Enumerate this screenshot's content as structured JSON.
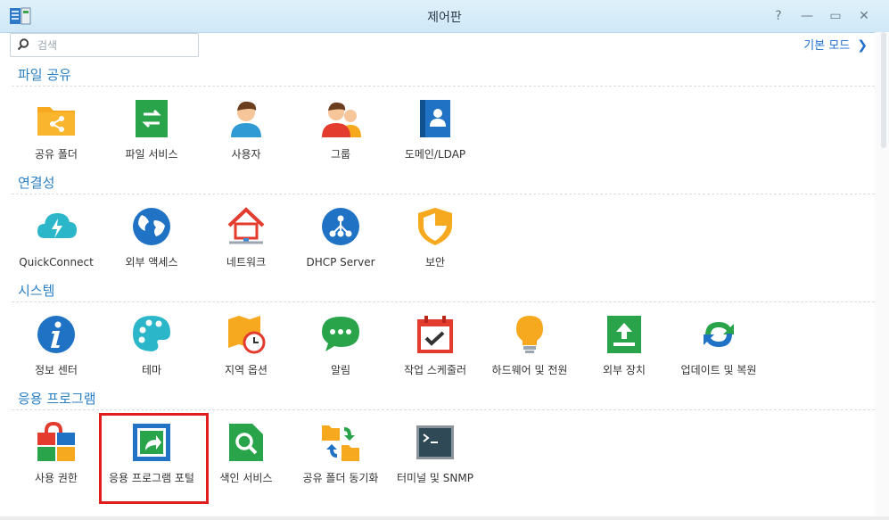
{
  "window": {
    "title": "제어판"
  },
  "toolbar": {
    "search_placeholder": "검색",
    "basic_mode_label": "기본 모드"
  },
  "sections": [
    {
      "title": "파일 공유",
      "items": [
        "공유 폴더",
        "파일 서비스",
        "사용자",
        "그룹",
        "도메인/LDAP"
      ]
    },
    {
      "title": "연결성",
      "items": [
        "QuickConnect",
        "외부 액세스",
        "네트워크",
        "DHCP Server",
        "보안"
      ]
    },
    {
      "title": "시스템",
      "items": [
        "정보 센터",
        "테마",
        "지역 옵션",
        "알림",
        "작업 스케줄러",
        "하드웨어 및 전원",
        "외부 장치",
        "업데이트 및 복원"
      ]
    },
    {
      "title": "응용 프로그램",
      "items": [
        "사용 권한",
        "응용 프로그램 포털",
        "색인 서비스",
        "공유 폴더 동기화",
        "터미널 및 SNMP"
      ]
    }
  ],
  "colors": {
    "accent": "#2b7fc3",
    "highlight": "#e01e1e"
  }
}
